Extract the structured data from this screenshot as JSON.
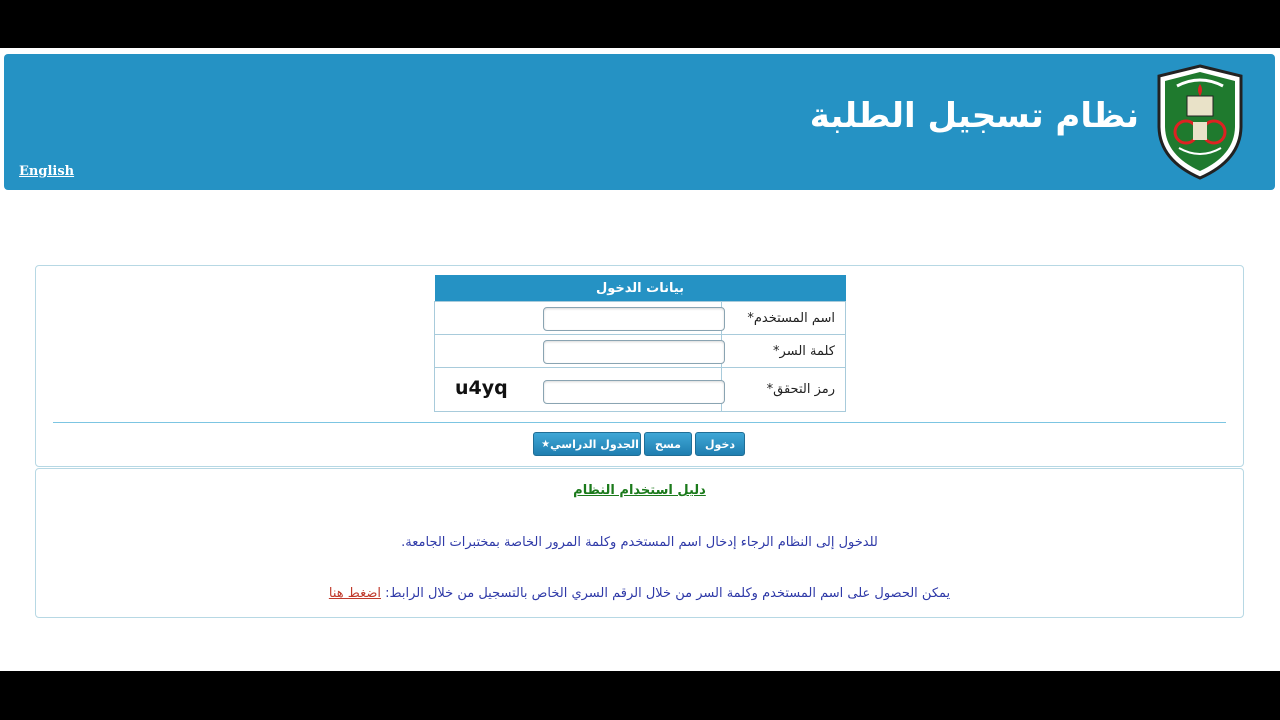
{
  "header": {
    "title": "نظام تسجيل الطلبة",
    "english_link": "English",
    "logo_icon": "university-crest-icon"
  },
  "login": {
    "table_title": "بيانات الدخول",
    "username_label": "اسم المستخدم*",
    "password_label": "كلمة السر*",
    "captcha_label": "رمز التحقق*",
    "captcha_code": "u4yq",
    "username_value": "",
    "password_value": "",
    "captcha_value": ""
  },
  "buttons": {
    "login": "دخول",
    "clear": "مسح",
    "schedule": "الجدول الدراسي",
    "schedule_icon": "star-icon"
  },
  "guide": {
    "title": "دليل استخدام النظام",
    "line1": "للدخول إلى النظام الرجاء إدخال اسم المستخدم وكلمة المرور الخاصة بمختبرات الجامعة.",
    "line2_prefix": "يمكن الحصول على اسم المستخدم وكلمة السر من خلال الرقم السري الخاص بالتسجيل من خلال الرابط:",
    "link_text": "اضغط هنا"
  },
  "colors": {
    "header_bg": "#2592c4",
    "guide_title": "#1b7a1b",
    "guide_text": "#2f3aa8",
    "link": "#c0392b"
  }
}
